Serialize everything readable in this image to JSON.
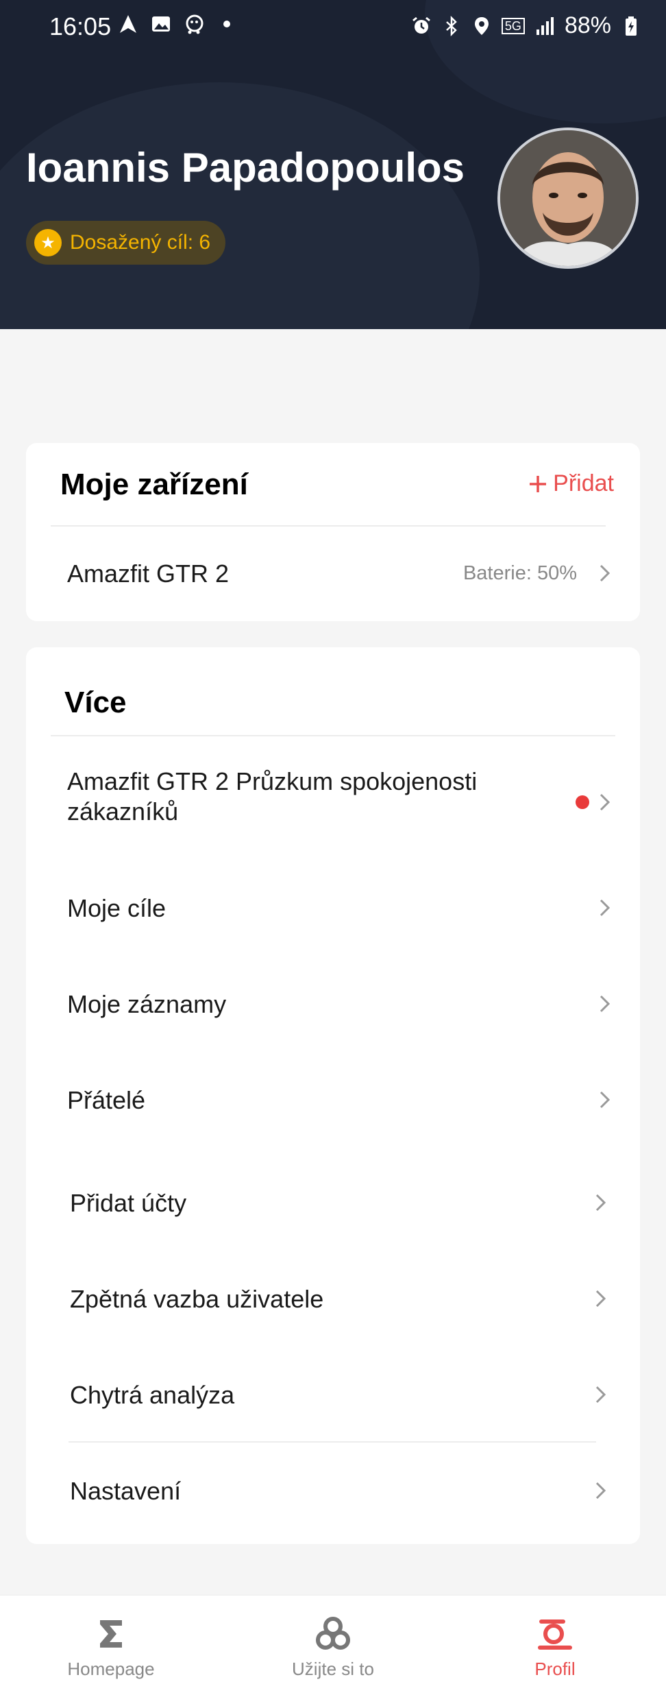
{
  "status_bar": {
    "time": "16:05",
    "network": "5G",
    "battery": "88%"
  },
  "profile": {
    "name": "Ioannis Papadopoulos",
    "goal_badge": "Dosažený cíl: 6"
  },
  "devices": {
    "title": "Moje zařízení",
    "add_label": "Přidat",
    "items": [
      {
        "name": "Amazfit GTR 2",
        "battery": "Baterie: 50%"
      }
    ]
  },
  "more": {
    "title": "Více",
    "items": [
      {
        "label": "Amazfit GTR 2 Průzkum spokojenosti zákazníků",
        "has_dot": true
      },
      {
        "label": "Moje cíle"
      },
      {
        "label": "Moje záznamy"
      },
      {
        "label": "Přátelé"
      },
      {
        "label": "Přidat účty"
      },
      {
        "label": "Zpětná vazba uživatele"
      },
      {
        "label": "Chytrá analýza"
      },
      {
        "label": "Nastavení"
      }
    ]
  },
  "bottom_nav": {
    "items": [
      {
        "label": "Homepage",
        "icon": "sigma-icon"
      },
      {
        "label": "Užijte si to",
        "icon": "knot-icon"
      },
      {
        "label": "Profil",
        "icon": "profile-icon",
        "active": true
      }
    ]
  },
  "colors": {
    "accent": "#e94e4e",
    "header_bg": "#1b2232",
    "badge_text": "#f5b400"
  }
}
